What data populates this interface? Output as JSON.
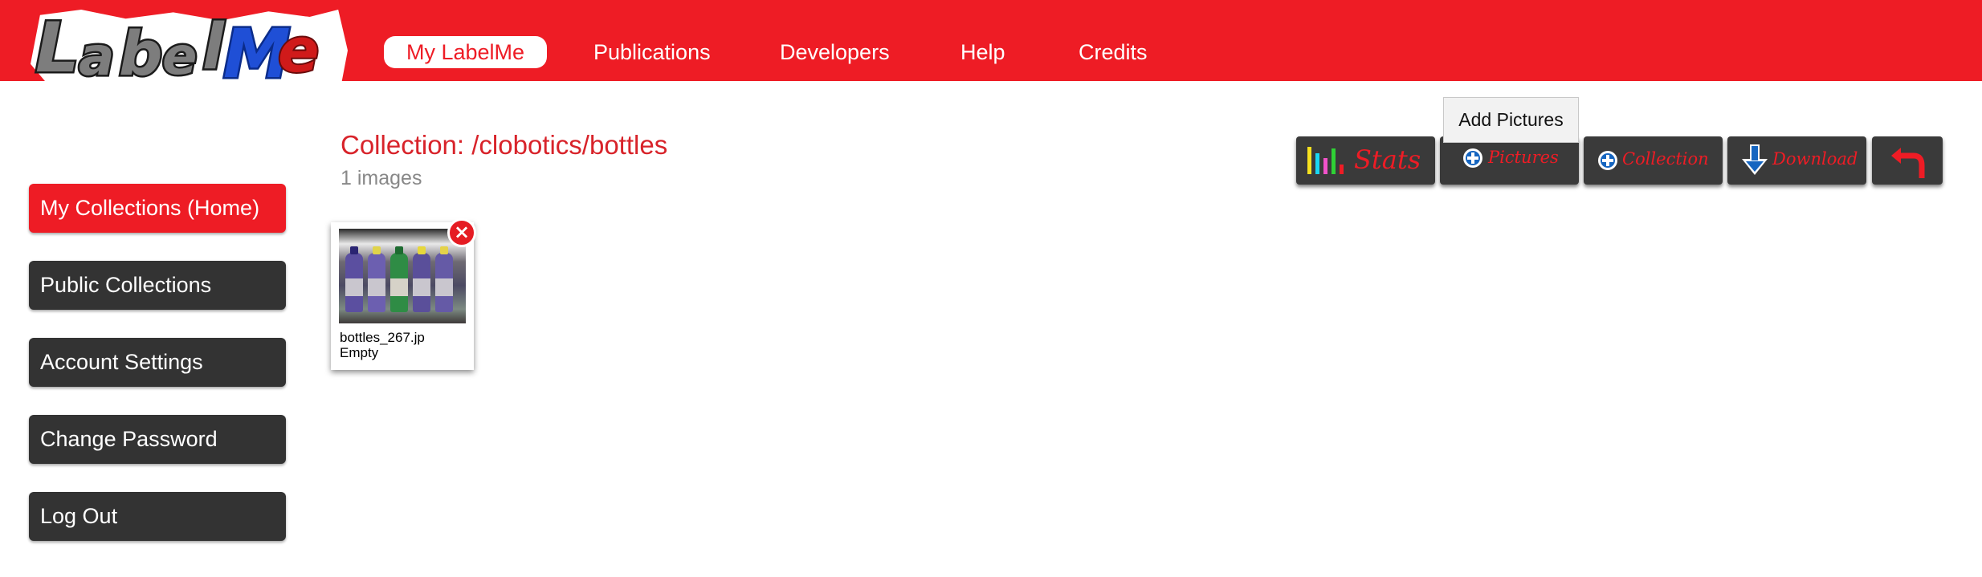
{
  "header": {
    "logo_text": "LabelMe",
    "nav": [
      "My LabelMe",
      "Publications",
      "Developers",
      "Help",
      "Credits"
    ]
  },
  "sidebar": {
    "items": [
      "My Collections (Home)",
      "Public Collections",
      "Account Settings",
      "Change Password",
      "Log Out"
    ]
  },
  "collection": {
    "title": "Collection: /clobotics/bottles",
    "count": "1 images"
  },
  "images": [
    {
      "name": "bottles_267.jp",
      "status": "Empty"
    }
  ],
  "toolbar": {
    "stats": "Stats",
    "pictures": "Pictures",
    "collection": "Collection",
    "download": "Download",
    "tooltip": "Add Pictures"
  },
  "icons": {
    "stats": "bar-chart-icon",
    "pictures": "plus-circle-icon",
    "collection": "plus-circle-icon",
    "download": "download-arrow-icon",
    "back": "undo-arrow-icon",
    "delete": "delete-x-icon"
  },
  "colors": {
    "brand_red": "#ee1c25",
    "dark_button": "#333333",
    "title_red": "#d8232a"
  }
}
